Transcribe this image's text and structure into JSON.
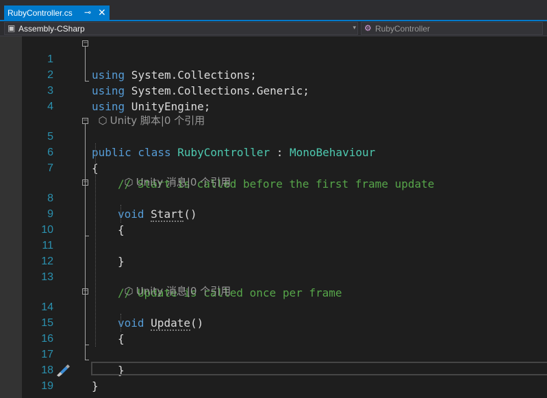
{
  "tab": {
    "title": "RubyController.cs",
    "pin_icon": "pin-icon",
    "close_icon": "close-icon"
  },
  "navbar": {
    "project": "Assembly-CSharp",
    "class_member": "RubyController",
    "project_icon": "csharp-project-icon",
    "class_icon": "class-icon"
  },
  "colors": {
    "accent": "#007acc",
    "keyword": "#569cd6",
    "type": "#4ec9b0",
    "comment": "#57a64a",
    "line_number": "#2b91af",
    "text": "#dcdcdc",
    "background": "#1e1e1e"
  },
  "code_lens": {
    "class_lens": "Unity 脚本|0 个引用",
    "start_lens": "Unity 消息|0 个引用",
    "update_lens": "Unity 消息|0 个引用"
  },
  "lines": {
    "l1": {
      "num": "1",
      "kw": "using",
      "rest": " System.Collections;"
    },
    "l2": {
      "num": "2",
      "kw": "using",
      "rest": " System.Collections.Generic;"
    },
    "l3": {
      "num": "3",
      "kw": "using",
      "rest": " UnityEngine;"
    },
    "l4": {
      "num": "4"
    },
    "l5": {
      "num": "5",
      "kw": "public class",
      "type": "RubyController",
      "colon": " : ",
      "base": "MonoBehaviour"
    },
    "l6": {
      "num": "6",
      "text": "{"
    },
    "l7": {
      "num": "7",
      "comment": "// Start is called before the first frame update"
    },
    "l8": {
      "num": "8",
      "kw": "void",
      "name": "Start",
      "paren": "()"
    },
    "l9": {
      "num": "9",
      "text": "{"
    },
    "l10": {
      "num": "10"
    },
    "l11": {
      "num": "11",
      "text": "}"
    },
    "l12": {
      "num": "12"
    },
    "l13": {
      "num": "13",
      "comment": "// Update is called once per frame"
    },
    "l14": {
      "num": "14",
      "kw": "void",
      "name": "Update",
      "paren": "()"
    },
    "l15": {
      "num": "15",
      "text": "{"
    },
    "l16": {
      "num": "16"
    },
    "l17": {
      "num": "17",
      "text": "}"
    },
    "l18": {
      "num": "18",
      "text": "}"
    },
    "l19": {
      "num": "19"
    }
  },
  "gutter_icon": "quick-actions-brush-icon"
}
